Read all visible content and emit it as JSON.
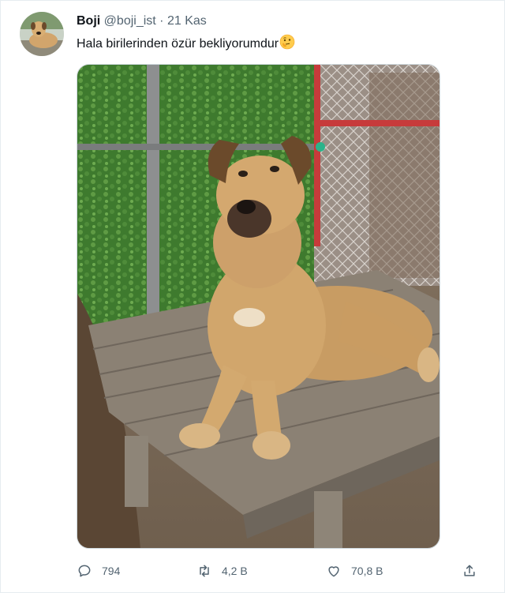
{
  "tweet": {
    "author_name": "Boji",
    "handle": "@boji_ist",
    "separator": "·",
    "date": "21 Kas",
    "text": "Hala birilerinden özür bekliyorumdur",
    "emoji": "thinking-face",
    "avatar": "dog-avatar",
    "media": "photo-dog-on-picnic-table"
  },
  "actions": {
    "reply_count": "794",
    "retweet_count": "4,2 B",
    "like_count": "70,8 B",
    "share_icon": "share-icon"
  },
  "colors": {
    "text": "#0f1419",
    "secondary": "#536471",
    "border": "#cfd9de"
  }
}
